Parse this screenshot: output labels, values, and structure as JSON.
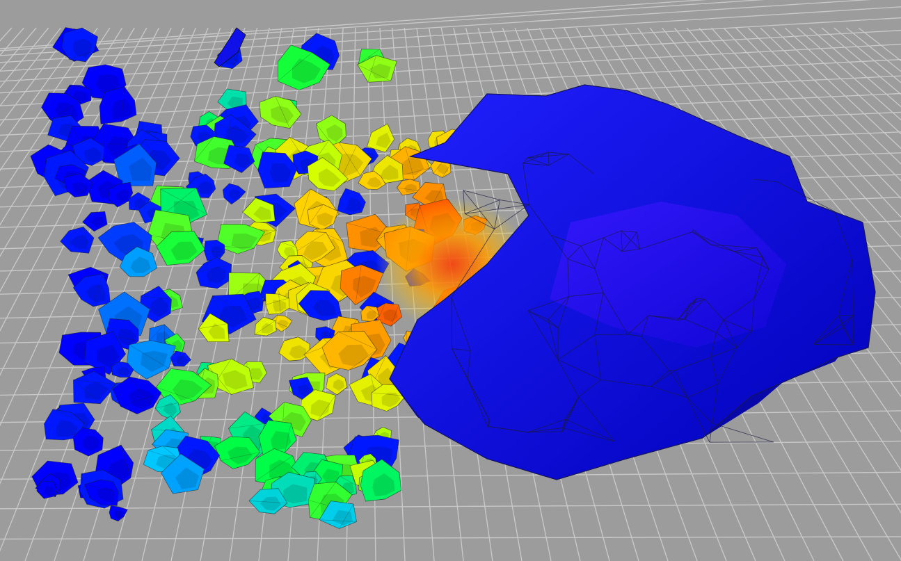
{
  "scene": {
    "background": "#9c9c9c",
    "grid_color": "#c8c8c8",
    "colormap": [
      "#0000ff",
      "#00c8ff",
      "#00ff40",
      "#d8ff00",
      "#ffd000",
      "#ff7000",
      "#ff2000"
    ],
    "mesh_edge_color": "#1a1a40",
    "large_body_color": "#1010e0"
  }
}
